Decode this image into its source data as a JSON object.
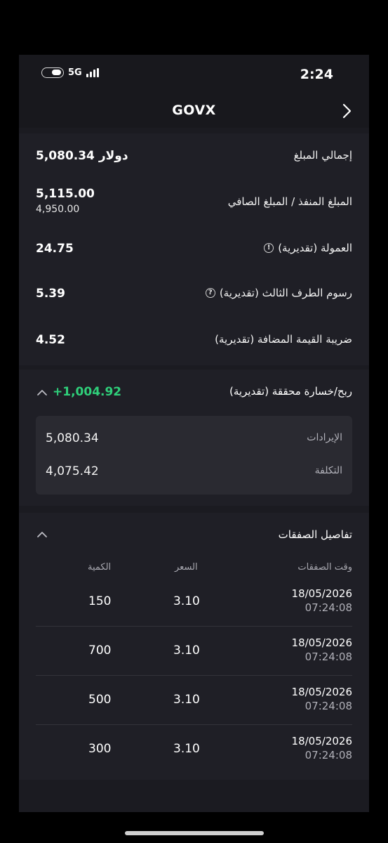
{
  "status_bar": {
    "time": "2:24",
    "network": "5G",
    "battery_level": 0.5
  },
  "header": {
    "title": "GOVX",
    "back_icon": "chevron-right-icon"
  },
  "summary": {
    "total_amount": {
      "label": "إجمالي المبلغ",
      "value": "5,080.34 دولار"
    },
    "executed_net": {
      "label": "المبلغ المنفذ / المبلغ الصافي",
      "value": "5,115.00",
      "sub_value": "4,950.00"
    },
    "commission": {
      "label": "العمولة (تقديرية)",
      "value": "24.75",
      "icon": "!"
    },
    "third_party_fees": {
      "label": "رسوم الطرف الثالث (تقديرية)",
      "value": "5.39",
      "icon": "?"
    },
    "vat": {
      "label": "ضريبة القيمة المضافة (تقديرية)",
      "value": "4.52"
    }
  },
  "realized_pnl": {
    "label": "ربح/خسارة محققة (تقديرية)",
    "value": "+1,004.92",
    "value_color": "#2fcf7a",
    "revenue": {
      "label": "الإيرادات",
      "value": "5,080.34"
    },
    "cost": {
      "label": "التكلفة",
      "value": "4,075.42"
    }
  },
  "trade_details": {
    "title": "تفاصيل الصفقات",
    "columns": {
      "time": "وقت الصفقات",
      "price": "السعر",
      "quantity": "الكمية"
    },
    "rows": [
      {
        "date": "18/05/2026",
        "time": "07:24:08",
        "price": "3.10",
        "quantity": "150"
      },
      {
        "date": "18/05/2026",
        "time": "07:24:08",
        "price": "3.10",
        "quantity": "700"
      },
      {
        "date": "18/05/2026",
        "time": "07:24:08",
        "price": "3.10",
        "quantity": "500"
      },
      {
        "date": "18/05/2026",
        "time": "07:24:08",
        "price": "3.10",
        "quantity": "300"
      }
    ]
  }
}
